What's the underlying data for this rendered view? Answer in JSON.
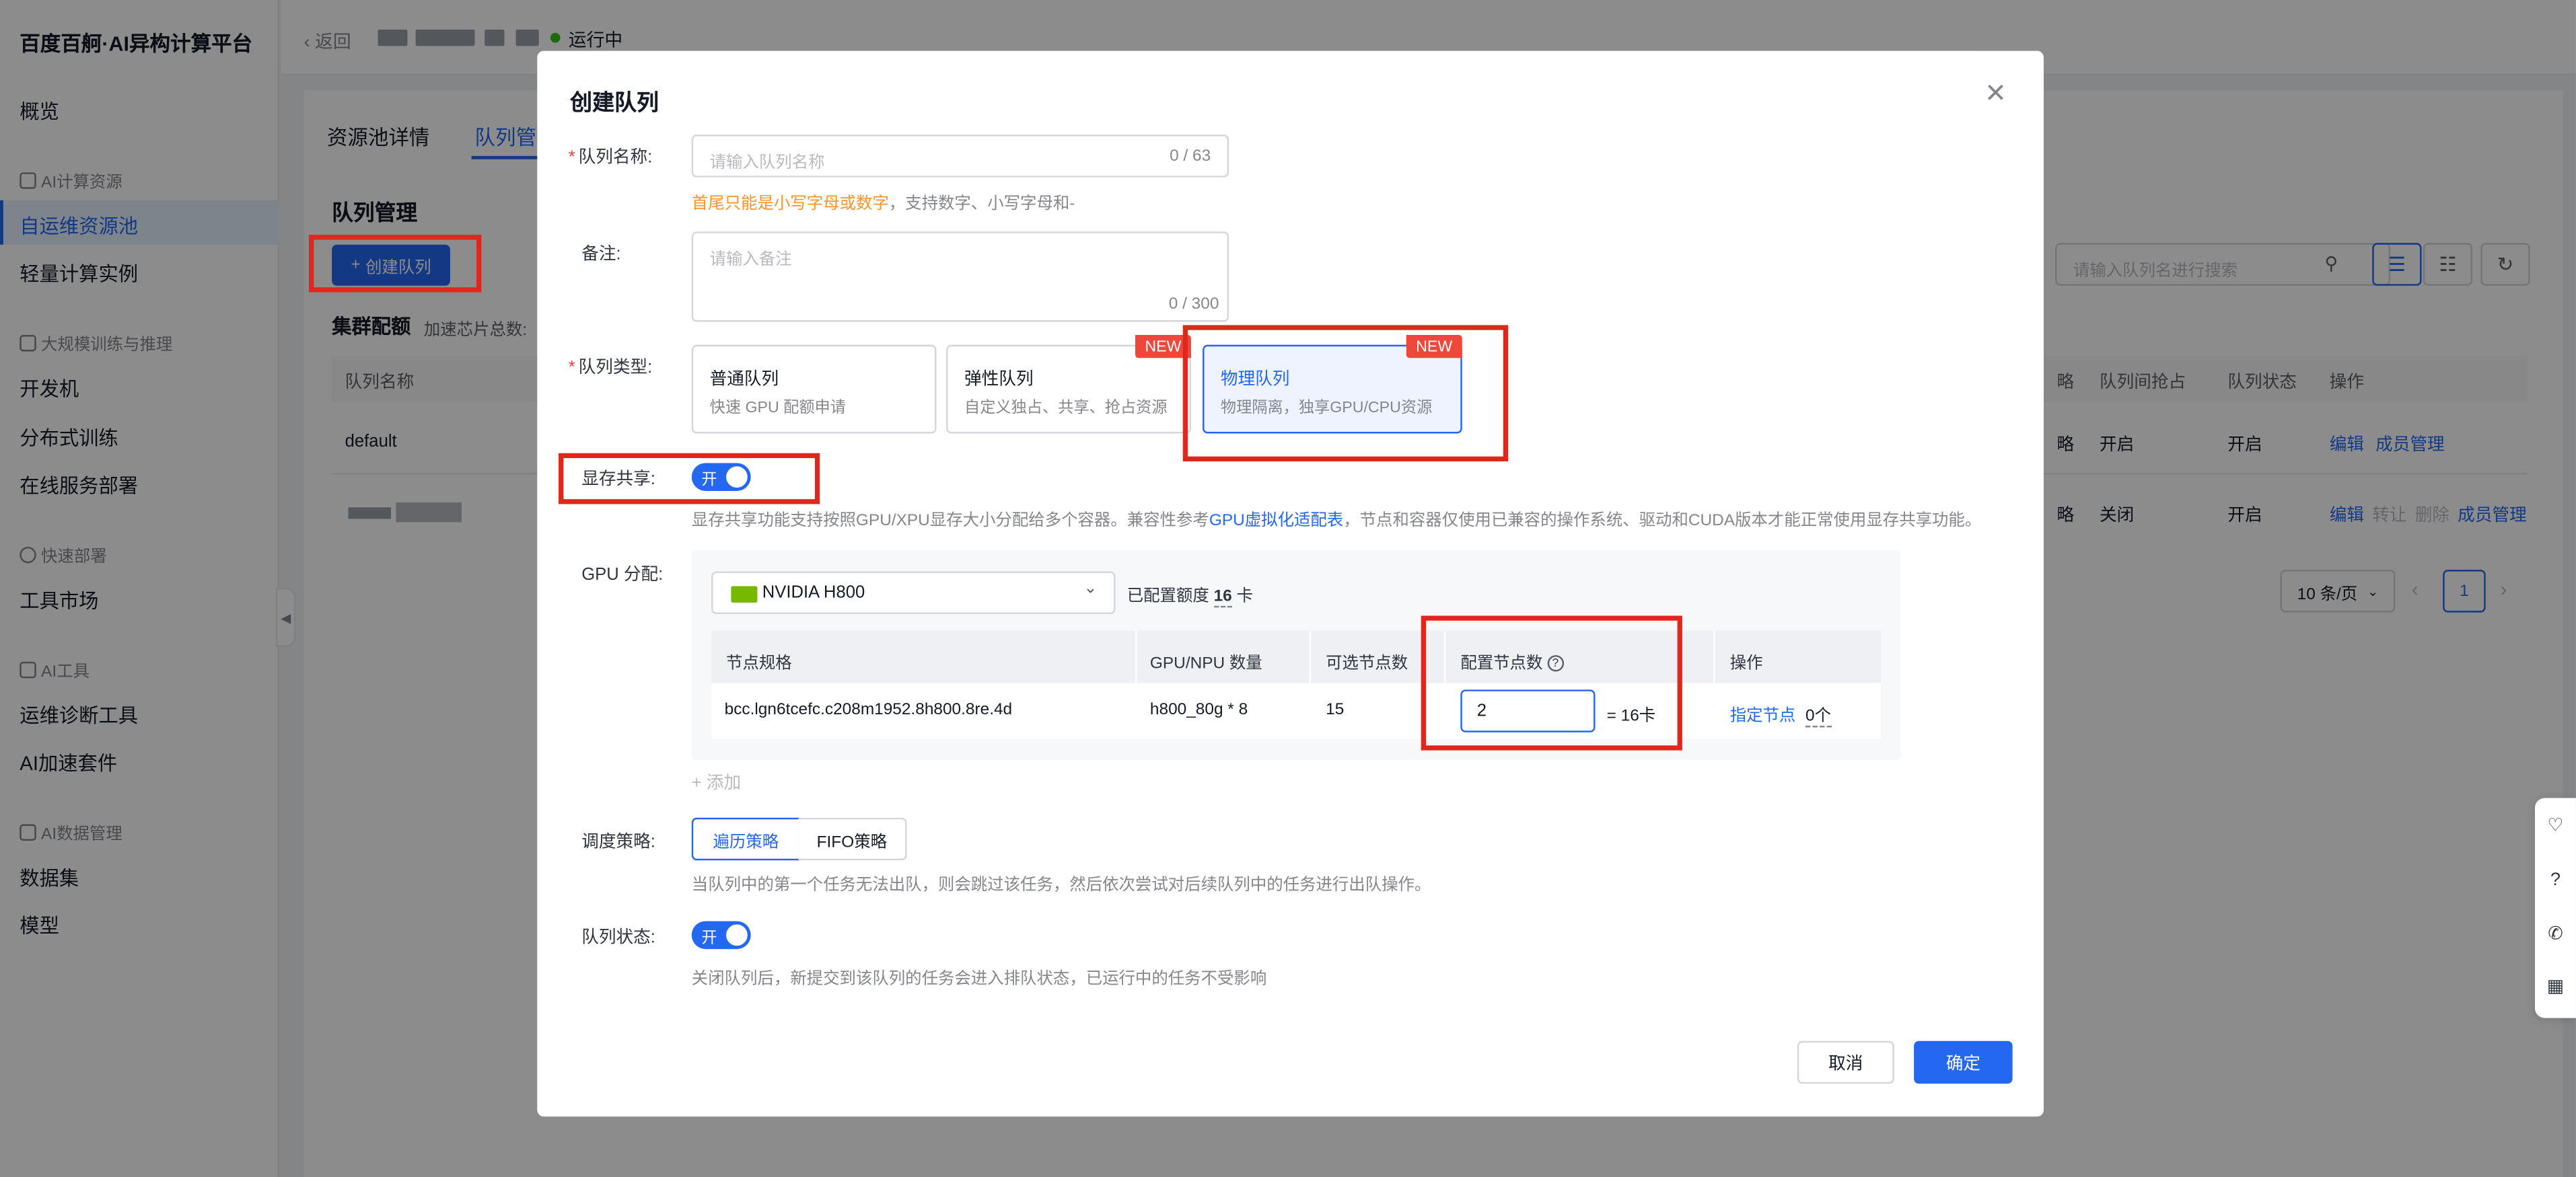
{
  "sidebar": {
    "brand": "百度百舸·AI异构计算平台",
    "overview": "概览",
    "group_compute": "AI计算资源",
    "self_pool": "自运维资源池",
    "light_instance": "轻量计算实例",
    "group_train": "大规模训练与推理",
    "dev_machine": "开发机",
    "dist_train": "分布式训练",
    "online_serve": "在线服务部署",
    "group_quick": "快速部署",
    "tool_market": "工具市场",
    "group_tools": "AI工具",
    "ops_diag": "运维诊断工具",
    "ai_accel": "AI加速套件",
    "group_data": "AI数据管理",
    "dataset": "数据集",
    "model": "模型"
  },
  "topbar": {
    "back": "返回",
    "status": "运行中"
  },
  "background": {
    "tab_detail": "资源池详情",
    "tab_queue": "队列管理",
    "section_title": "队列管理",
    "create_btn": "创建队列",
    "cluster_label": "集群配额",
    "cluster_sub": "加速芯片总数:",
    "search_placeholder": "请输入队列名进行搜索",
    "headers": {
      "name": "队列名称",
      "preempt": "队列间抢占",
      "status": "队列状态",
      "ops": "操作",
      "partial": "略"
    },
    "rows": [
      {
        "name": "default",
        "partial": "略",
        "preempt": "开启",
        "status": "开启",
        "op_edit": "编辑",
        "op_member": "成员管理"
      },
      {
        "name": "",
        "partial": "略",
        "preempt": "关闭",
        "status": "开启",
        "op_edit": "编辑",
        "op_transfer": "转让",
        "op_delete": "删除",
        "op_member": "成员管理"
      }
    ],
    "page_size": "10 条/页",
    "page_num": "1"
  },
  "dialog": {
    "title": "创建队列",
    "name_label": "队列名称:",
    "name_placeholder": "请输入队列名称",
    "name_counter": "0 / 63",
    "name_hint_warn": "首尾只能是小写字母或数字",
    "name_hint_rest": "，支持数字、小写字母和-",
    "remark_label": "备注:",
    "remark_placeholder": "请输入备注",
    "remark_counter": "0 / 300",
    "type_label": "队列类型:",
    "types": [
      {
        "title": "普通队列",
        "desc": "快速 GPU 配额申请",
        "tag": ""
      },
      {
        "title": "弹性队列",
        "desc": "自定义独占、共享、抢占资源",
        "tag": "NEW"
      },
      {
        "title": "物理队列",
        "desc": "物理隔离，独享GPU/CPU资源",
        "tag": "NEW"
      }
    ],
    "mem_share_label": "显存共享:",
    "mem_share_switch": "开",
    "mem_share_hint_1": "显存共享功能支持按照GPU/XPU显存大小分配给多个容器。兼容性参考",
    "mem_share_hint_link": "GPU虚拟化适配表",
    "mem_share_hint_2": "，节点和容器仅使用已兼容的操作系统、驱动和CUDA版本才能正常使用显存共享功能。",
    "gpu_label": "GPU 分配:",
    "gpu_model": "NVIDIA H800",
    "quota_prefix": "已配置额度",
    "quota_value": "16",
    "quota_unit": "卡",
    "table_headers": {
      "spec": "节点规格",
      "count": "GPU/NPU 数量",
      "avail": "可选节点数",
      "config": "配置节点数",
      "ops": "操作"
    },
    "table_row": {
      "spec": "bcc.lgn6tcefc.c208m1952.8h800.8re.4d",
      "count": "h800_80g * 8",
      "avail": "15",
      "config_value": "2",
      "equals": "= 16卡",
      "assign": "指定节点",
      "assigned": "0个"
    },
    "add": "添加",
    "sched_label": "调度策略:",
    "sched_opt1": "遍历策略",
    "sched_opt2": "FIFO策略",
    "sched_hint": "当队列中的第一个任务无法出队，则会跳过该任务，然后依次尝试对后续队列中的任务进行出队操作。",
    "state_label": "队列状态:",
    "state_switch": "开",
    "state_hint": "关闭队列后，新提交到该队列的任务会进入排队状态，已运行中的任务不受影响",
    "cancel": "取消",
    "confirm": "确定"
  },
  "colors": {
    "primary": "#2468f2",
    "highlight_box": "#e0271d",
    "new_tag": "#f0473b",
    "warn": "#ff9326"
  }
}
